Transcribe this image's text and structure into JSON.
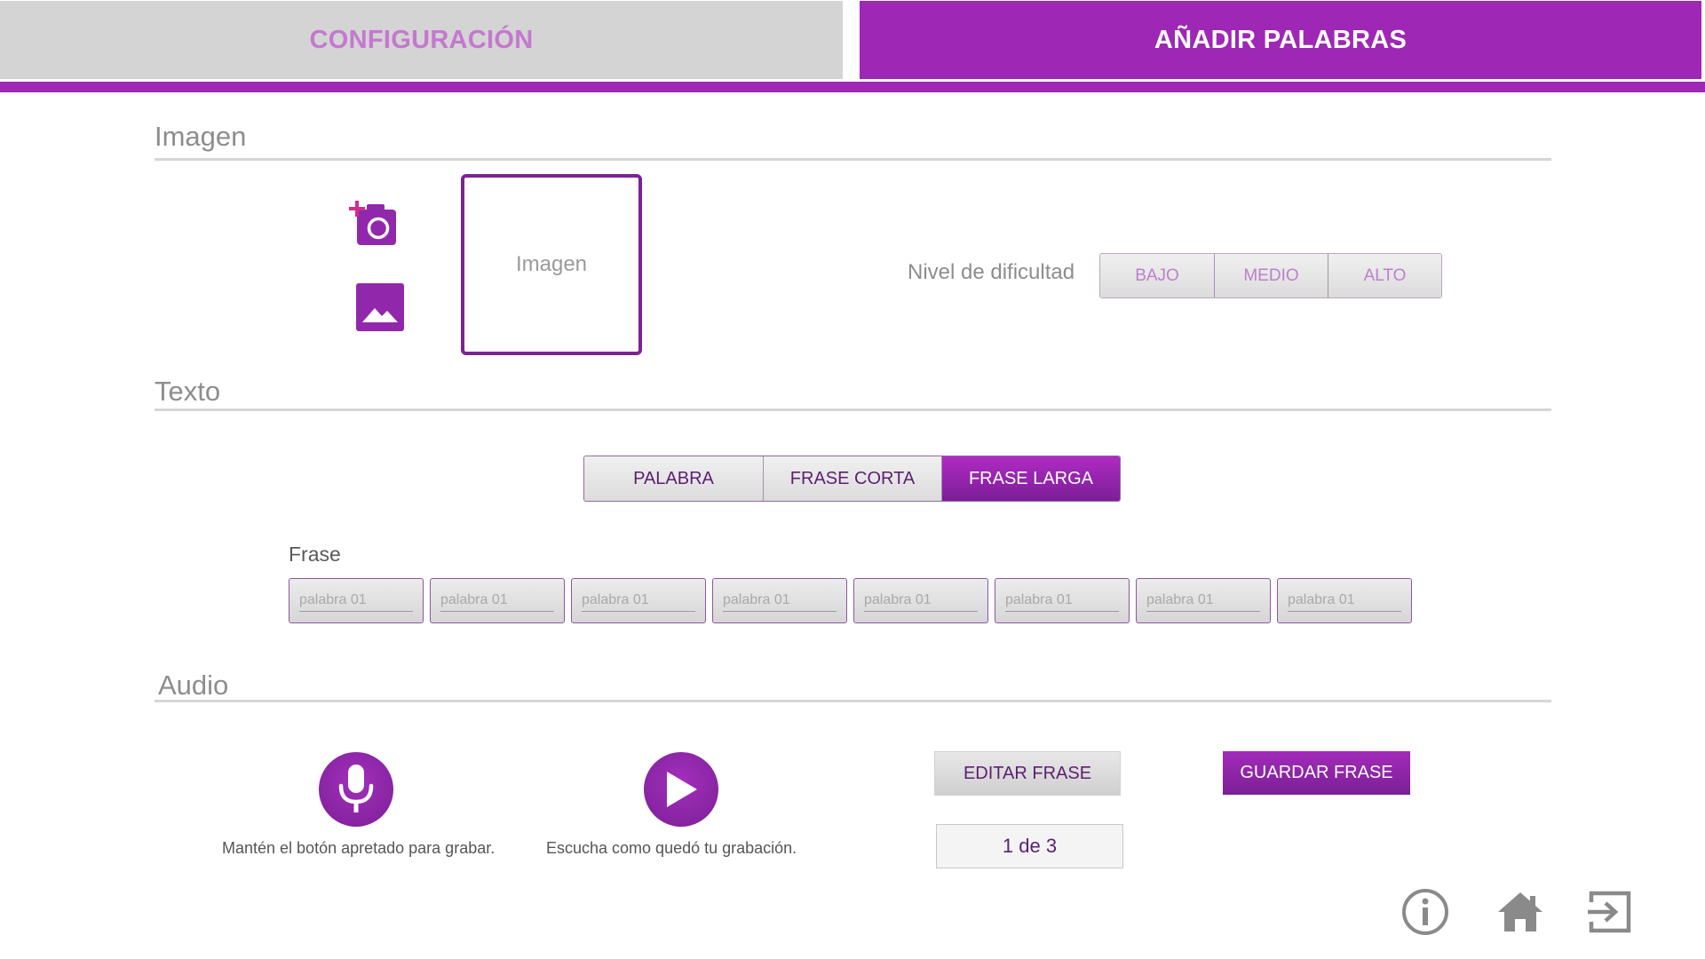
{
  "tabs": {
    "config_label": "CONFIGURACIÓN",
    "add_words_label": "AÑADIR PALABRAS",
    "active": "add_words"
  },
  "sections": {
    "image_title": "Imagen",
    "text_title": "Texto",
    "audio_title": "Audio"
  },
  "image": {
    "camera_icon": "add-photo-camera-icon",
    "gallery_icon": "image-gallery-icon",
    "placeholder_label": "Imagen"
  },
  "difficulty": {
    "label": "Nivel de dificultad",
    "options": [
      "BAJO",
      "MEDIO",
      "ALTO"
    ]
  },
  "text_type": {
    "options": [
      "PALABRA",
      "FRASE CORTA",
      "FRASE LARGA"
    ],
    "selected": "FRASE LARGA"
  },
  "phrase": {
    "label": "Frase",
    "words": [
      "palabra 01",
      "palabra 01",
      "palabra 01",
      "palabra 01",
      "palabra 01",
      "palabra 01",
      "palabra 01",
      "palabra 01"
    ]
  },
  "audio": {
    "record_hint": "Mantén el botón apretado para grabar.",
    "play_hint": "Escucha como quedó tu grabación.",
    "edit_label": "EDITAR FRASE",
    "save_label": "GUARDAR FRASE",
    "counter": "1 de 3"
  },
  "footer": {
    "icons": [
      "info-icon",
      "home-icon",
      "exit-icon"
    ]
  },
  "colors": {
    "accent": "#9e27b5",
    "accent_dark": "#7b1f96",
    "tab_inactive_bg": "#d4d4d4",
    "tab_inactive_text": "#c478cf",
    "section_gray": "#8d8d8d"
  }
}
